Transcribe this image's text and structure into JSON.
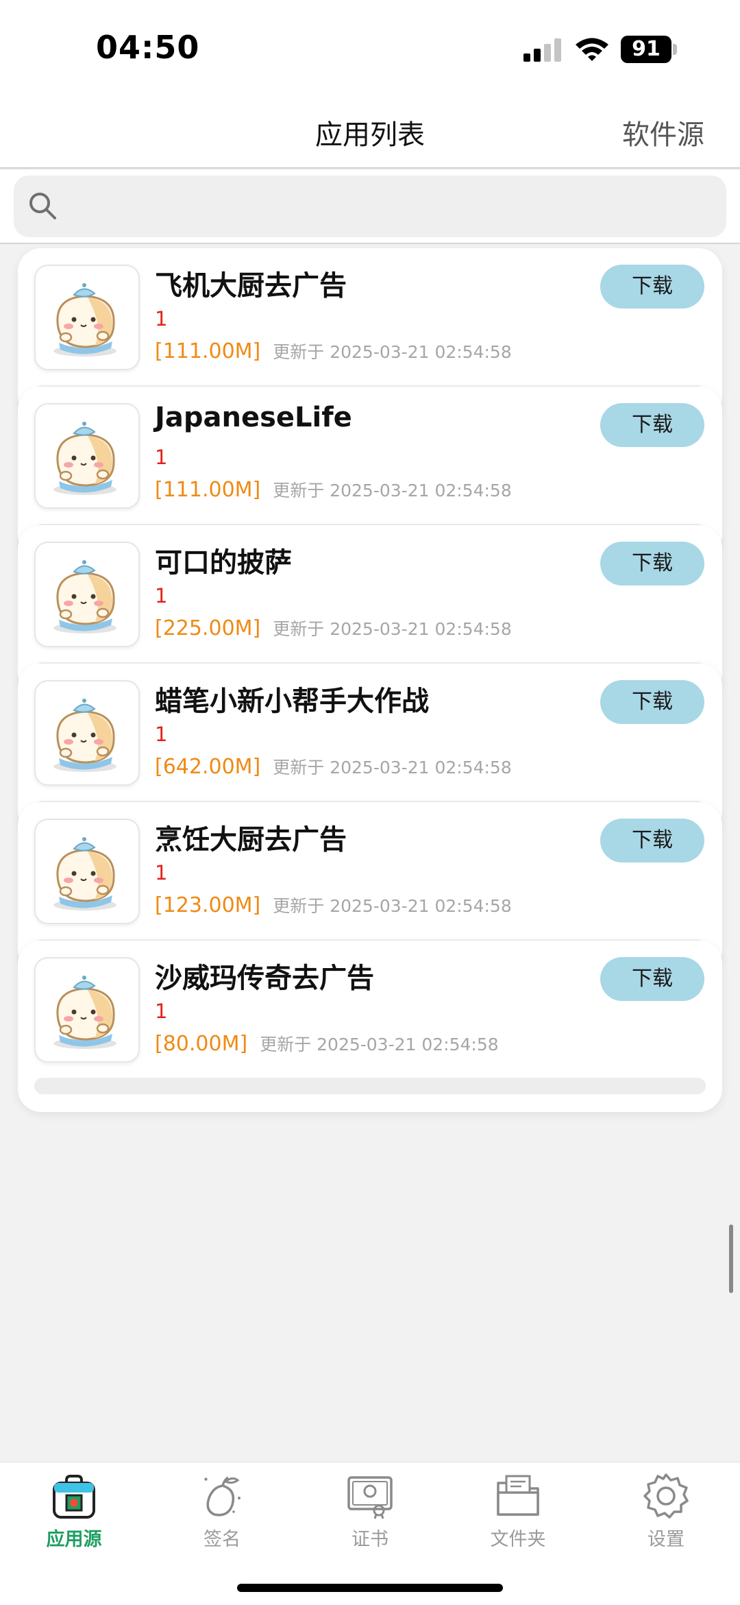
{
  "status_bar": {
    "time": "04:50",
    "battery": "91"
  },
  "nav": {
    "title": "应用列表",
    "right_label": "软件源"
  },
  "search": {
    "placeholder": ""
  },
  "apps": [
    {
      "name": "飞机大厨去广告",
      "version": "1",
      "size": "[111.00M]",
      "updated": "更新于 2025-03-21 02:54:58",
      "download_label": "下载",
      "progress": 0
    },
    {
      "name": "JapaneseLife",
      "version": "1",
      "size": "[111.00M]",
      "updated": "更新于 2025-03-21 02:54:58",
      "download_label": "下载",
      "progress": 0
    },
    {
      "name": "可口的披萨",
      "version": "1",
      "size": "[225.00M]",
      "updated": "更新于 2025-03-21 02:54:58",
      "download_label": "下载",
      "progress": 0
    },
    {
      "name": "蜡笔小新小帮手大作战",
      "version": "1",
      "size": "[642.00M]",
      "updated": "更新于 2025-03-21 02:54:58",
      "download_label": "下载",
      "progress": 0
    },
    {
      "name": "烹饪大厨去广告",
      "version": "1",
      "size": "[123.00M]",
      "updated": "更新于 2025-03-21 02:54:58",
      "download_label": "下载",
      "progress": 0
    },
    {
      "name": "沙威玛传奇去广告",
      "version": "1",
      "size": "[80.00M]",
      "updated": "更新于 2025-03-21 02:54:58",
      "download_label": "下载",
      "progress": 0
    }
  ],
  "tabs": [
    {
      "label": "应用源",
      "icon": "bag-icon",
      "active": true
    },
    {
      "label": "签名",
      "icon": "mango-icon",
      "active": false
    },
    {
      "label": "证书",
      "icon": "certificate-icon",
      "active": false
    },
    {
      "label": "文件夹",
      "icon": "folder-icon",
      "active": false
    },
    {
      "label": "设置",
      "icon": "gear-icon",
      "active": false
    }
  ],
  "colors": {
    "accent_green": "#1e9e62",
    "download_button": "#a8d7e6",
    "version_red": "#e0241b",
    "size_orange": "#ef8a14",
    "inactive_gray": "#9a9a9a"
  }
}
